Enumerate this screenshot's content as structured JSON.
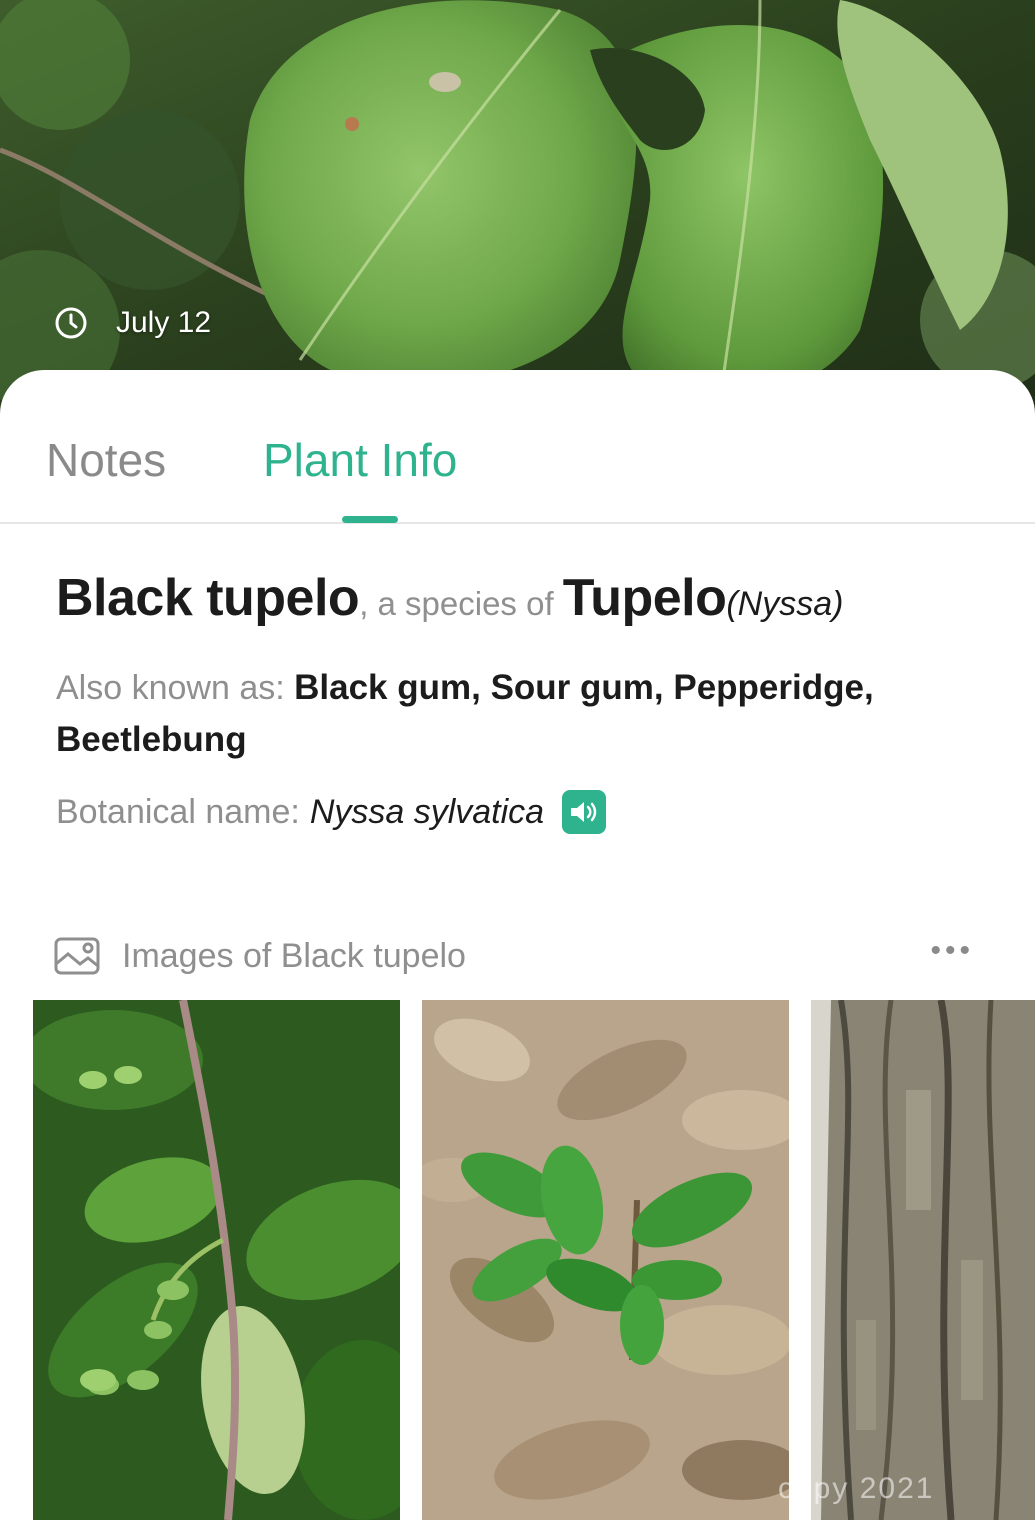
{
  "header": {
    "date": "July 12",
    "clock_icon": "clock-icon"
  },
  "tabs": [
    {
      "label": "Notes",
      "active": false
    },
    {
      "label": "Plant Info",
      "active": true
    }
  ],
  "plant": {
    "common_name": "Black tupelo",
    "species_connector": ", a species of ",
    "genus": "Tupelo",
    "genus_latin": "(Nyssa)",
    "aka_label": "Also known as: ",
    "aka_names": "Black gum, Sour gum, Pepperidge, Beetlebung",
    "botanical_label": "Botanical name:",
    "botanical_name": "Nyssa sylvatica",
    "speaker_icon": "speaker-icon"
  },
  "images": {
    "header_label": "Images of Black tupelo",
    "gallery_icon": "gallery-icon",
    "more_label": "•••",
    "thumbnails": [
      {
        "subject": "leaves-with-fruit"
      },
      {
        "subject": "seedling-on-leaf-litter"
      },
      {
        "subject": "bark"
      }
    ]
  },
  "watermark": "copy 2021",
  "colors": {
    "accent": "#2fb38e",
    "text_primary": "#1c1c1c",
    "text_secondary": "#8f8f8f"
  }
}
